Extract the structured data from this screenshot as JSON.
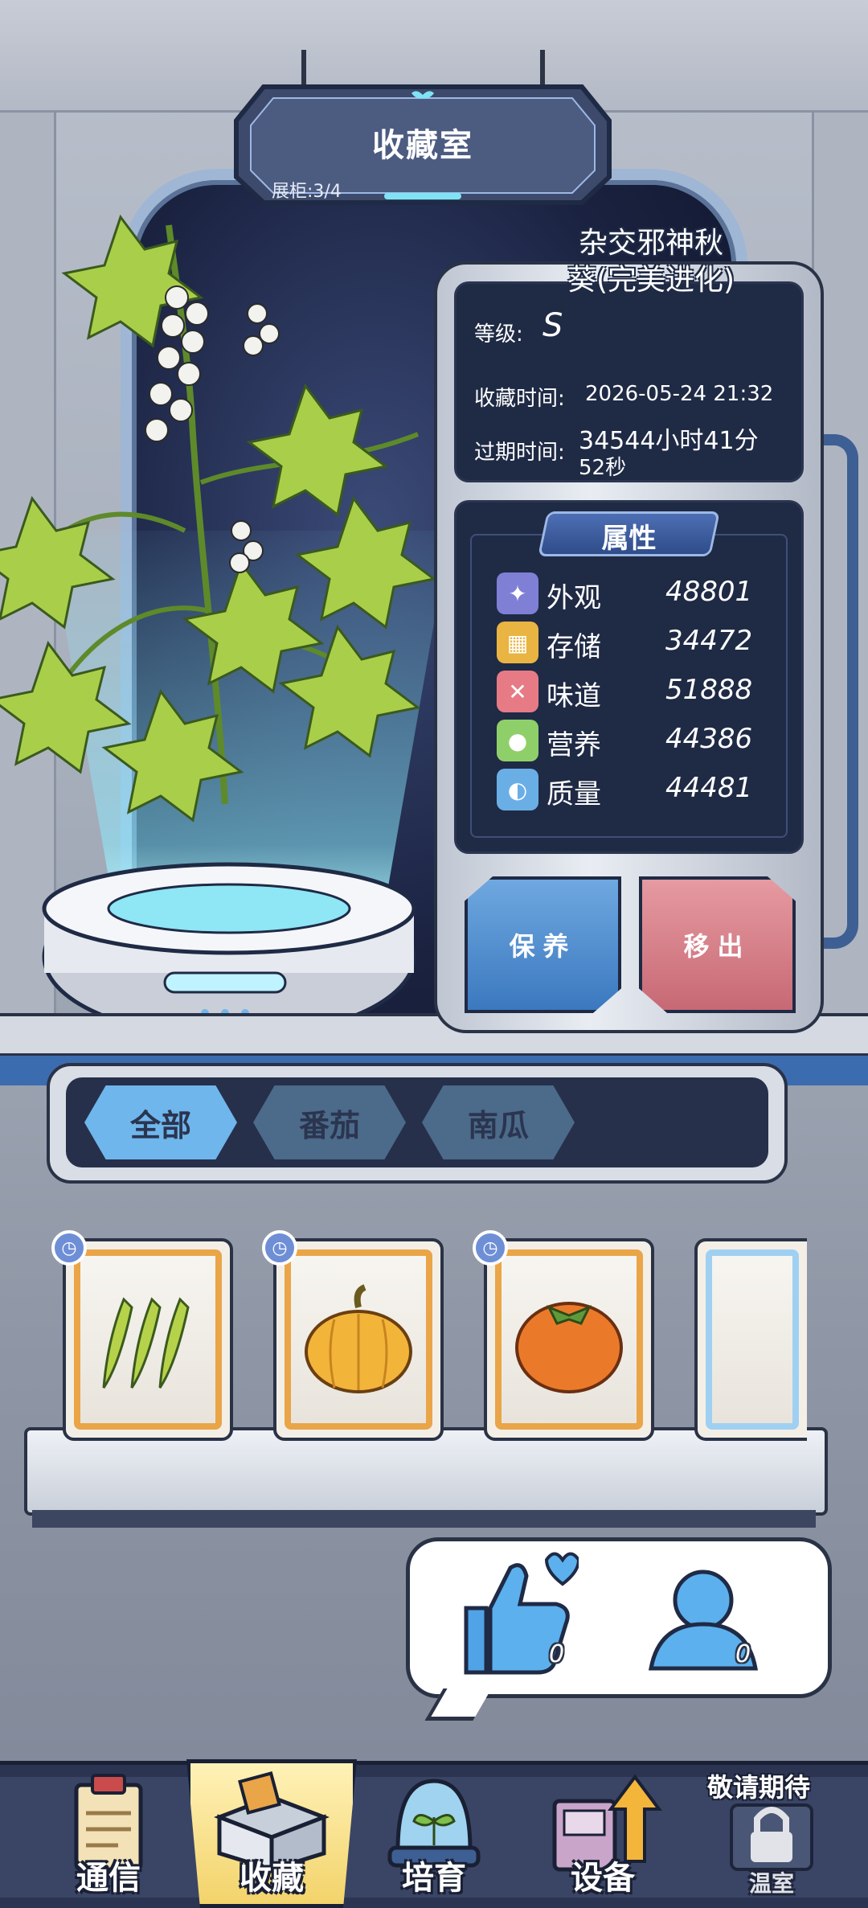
{
  "header": {
    "title": "收藏室",
    "cabinet_label": "展柜:3/4"
  },
  "plant": {
    "name_line1": "杂交邪神秋",
    "name_line2": "葵(完美进化)",
    "grade_label": "等级:",
    "grade_value": "S",
    "collect_time_label": "收藏时间:",
    "collect_time_value": "2026-05-24 21:32",
    "expire_time_label": "过期时间:",
    "expire_time_line1": "34544小时41分",
    "expire_time_line2": "52秒"
  },
  "attributes": {
    "title": "属性",
    "items": [
      {
        "name": "外观",
        "value": "48801",
        "icon": "sparkle-icon",
        "color": "#7f7fd6"
      },
      {
        "name": "存储",
        "value": "34472",
        "icon": "crate-icon",
        "color": "#e9b441"
      },
      {
        "name": "味道",
        "value": "51888",
        "icon": "utensils-icon",
        "color": "#e67b86"
      },
      {
        "name": "营养",
        "value": "44386",
        "icon": "lemon-icon",
        "color": "#8fcf6a"
      },
      {
        "name": "质量",
        "value": "44481",
        "icon": "muscle-icon",
        "color": "#6aaee6"
      }
    ]
  },
  "actions": {
    "keep_label": "保养",
    "remove_label": "移出"
  },
  "filters": {
    "tabs": [
      {
        "label": "全部",
        "active": true
      },
      {
        "label": "番茄",
        "active": false
      },
      {
        "label": "南瓜",
        "active": false
      }
    ]
  },
  "collection": {
    "cards": [
      {
        "item": "okra",
        "icon": "okra-icon",
        "timed": true
      },
      {
        "item": "pumpkin",
        "icon": "pumpkin-icon",
        "timed": true
      },
      {
        "item": "persimmon",
        "icon": "persimmon-icon",
        "timed": true
      },
      {
        "item": "empty",
        "icon": "empty-slot-icon",
        "timed": false
      }
    ]
  },
  "social": {
    "likes": "0",
    "visitors": "0"
  },
  "nav": {
    "items": [
      {
        "label": "通信",
        "icon": "clipboard-icon"
      },
      {
        "label": "收藏",
        "icon": "box-icon"
      },
      {
        "label": "培育",
        "icon": "sprout-dome-icon"
      },
      {
        "label": "设备",
        "icon": "machine-upgrade-icon"
      },
      {
        "label": "温室",
        "icon": "lock-icon"
      }
    ],
    "coming_soon": "敬请期待"
  },
  "colors": {
    "accent_blue": "#6fb6ec",
    "panel_dark": "#1f2a45",
    "keep_button": "#3b78bf",
    "remove_button": "#c76975"
  }
}
